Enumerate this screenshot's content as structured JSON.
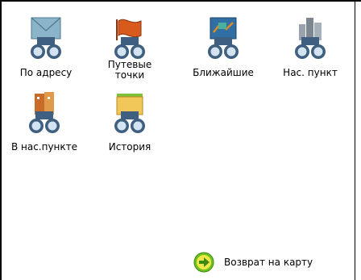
{
  "menu": {
    "items": [
      {
        "label": "По адресу",
        "icon": "envelope-binoculars-icon"
      },
      {
        "label_line1": "Путевые",
        "label_line2": "точки",
        "icon": "flag-binoculars-icon"
      },
      {
        "label": "Ближайшие",
        "icon": "map-binoculars-icon"
      },
      {
        "label": "Нас. пункт",
        "icon": "city-binoculars-icon"
      },
      {
        "label": "В нас.пункте",
        "icon": "building-binoculars-icon"
      },
      {
        "label": "История",
        "icon": "folder-binoculars-icon"
      }
    ]
  },
  "footer": {
    "return_label": "Возврат на карту",
    "return_icon": "arrow-right-circle-icon"
  },
  "colors": {
    "binocular_body": "#3e5f7f",
    "binocular_lens": "#d4e3f1",
    "accent_green": "#6cc21e"
  }
}
